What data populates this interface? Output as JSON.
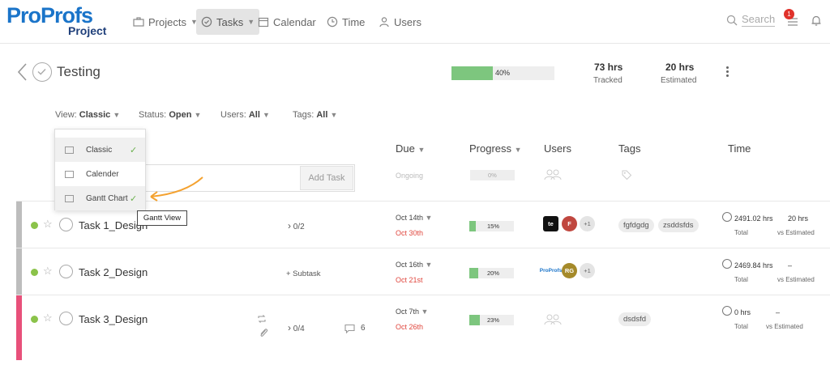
{
  "brand": {
    "logo": "ProProfs",
    "product": "Project"
  },
  "nav": {
    "projects": "Projects",
    "tasks": "Tasks",
    "calendar": "Calendar",
    "time": "Time",
    "users": "Users",
    "search_placeholder": "Search",
    "notification_count": "1"
  },
  "project": {
    "title": "Testing",
    "progress_pct": 40,
    "progress_label": "40%",
    "tracked_value": "73 hrs",
    "tracked_label": "Tracked",
    "estimated_value": "20 hrs",
    "estimated_label": "Estimated"
  },
  "filters": {
    "view_label": "View:",
    "view_value": "Classic",
    "status_label": "Status:",
    "status_value": "Open",
    "users_label": "Users:",
    "users_value": "All",
    "tags_label": "Tags:",
    "tags_value": "All"
  },
  "view_menu": {
    "items": [
      {
        "label": "Classic",
        "checked": true
      },
      {
        "label": "Calender",
        "checked": false
      },
      {
        "label": "Gantt Chart",
        "checked": true
      }
    ],
    "tooltip": "Gantt View"
  },
  "columns": {
    "due": "Due",
    "progress": "Progress",
    "users": "Users",
    "tags": "Tags",
    "time": "Time"
  },
  "add_task": {
    "button": "Add Task",
    "due": "Ongoing",
    "progress_label": "0%",
    "progress_pct": 0
  },
  "tasks": [
    {
      "name": "Task 1_Design",
      "subtasks": "0/2",
      "due_start": "Oct 14th",
      "due_end": "Oct 30th",
      "progress_label": "15%",
      "progress_pct": 15,
      "avatars": [
        "te",
        "F"
      ],
      "extra_users": "+1",
      "tags": [
        "fgfdgdg",
        "zsddsfds"
      ],
      "time_total": "2491.02 hrs",
      "time_total_label": "Total",
      "time_est": "20 hrs",
      "time_est_label": "vs Estimated",
      "stripe_color": "#bdbdbd"
    },
    {
      "name": "Task 2_Design",
      "subtask_action": "+ Subtask",
      "due_start": "Oct 16th",
      "due_end": "Oct 21st",
      "progress_label": "20%",
      "progress_pct": 20,
      "avatars": [
        "ProProfs",
        "RG"
      ],
      "extra_users": "+1",
      "tags": [],
      "time_total": "2469.84 hrs",
      "time_total_label": "Total",
      "time_est": "–",
      "time_est_label": "vs Estimated",
      "stripe_color": "#bdbdbd"
    },
    {
      "name": "Task 3_Design",
      "subtasks": "0/4",
      "comments": "6",
      "due_start": "Oct 7th",
      "due_end": "Oct 26th",
      "progress_label": "23%",
      "progress_pct": 23,
      "avatars": [],
      "tags": [
        "dsdsfd"
      ],
      "time_total": "0 hrs",
      "time_total_label": "Total",
      "time_est": "–",
      "time_est_label": "vs Estimated",
      "stripe_color": "#e8507a"
    }
  ]
}
